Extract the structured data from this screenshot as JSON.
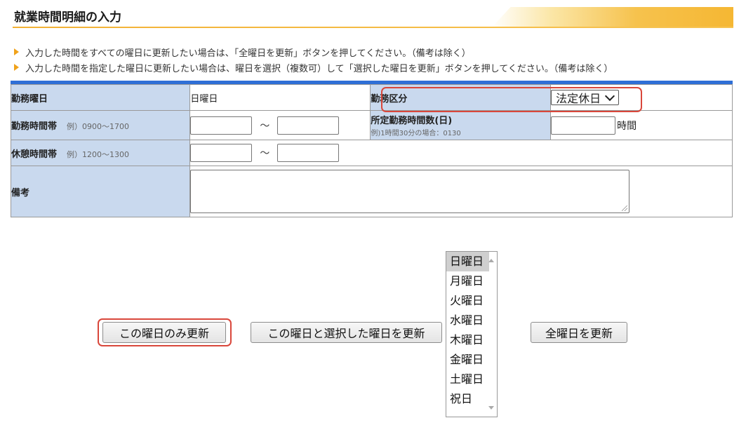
{
  "header": {
    "title": "就業時間明細の入力"
  },
  "notes": [
    "入力した時間をすべての曜日に更新したい場合は、「全曜日を更新」ボタンを押してください。（備考は除く）",
    "入力した時間を指定した曜日に更新したい場合は、曜日を選択（複数可）して「選択した曜日を更新」ボタンを押してください。（備考は除く）"
  ],
  "form": {
    "workday_label": "勤務曜日",
    "workday_value": "日曜日",
    "work_category_label": "勤務区分",
    "work_category_selected": "法定休日",
    "work_hours_label": "勤務時間帯",
    "work_hours_example": "例）0900〜1700",
    "range_sep": "〜",
    "scheduled_hours_label": "所定勤務時間数(日)",
    "scheduled_hours_example": "例)1時間30分の場合：0130",
    "hours_unit": "時間",
    "break_label": "休憩時間帯",
    "break_example": "例）1200〜1300",
    "remarks_label": "備考"
  },
  "buttons": {
    "update_this_day": "この曜日のみ更新",
    "update_this_and_selected": "この曜日と選択した曜日を更新",
    "update_all": "全曜日を更新"
  },
  "weekdays": {
    "options": [
      "日曜日",
      "月曜日",
      "火曜日",
      "水曜日",
      "木曜日",
      "金曜日",
      "土曜日",
      "祝日"
    ],
    "selected": "日曜日"
  },
  "colors": {
    "accent": "#f2b134",
    "label_bg": "#c9d9ee",
    "form_top_border": "#2f6fd6",
    "highlight": "#d9473b"
  }
}
